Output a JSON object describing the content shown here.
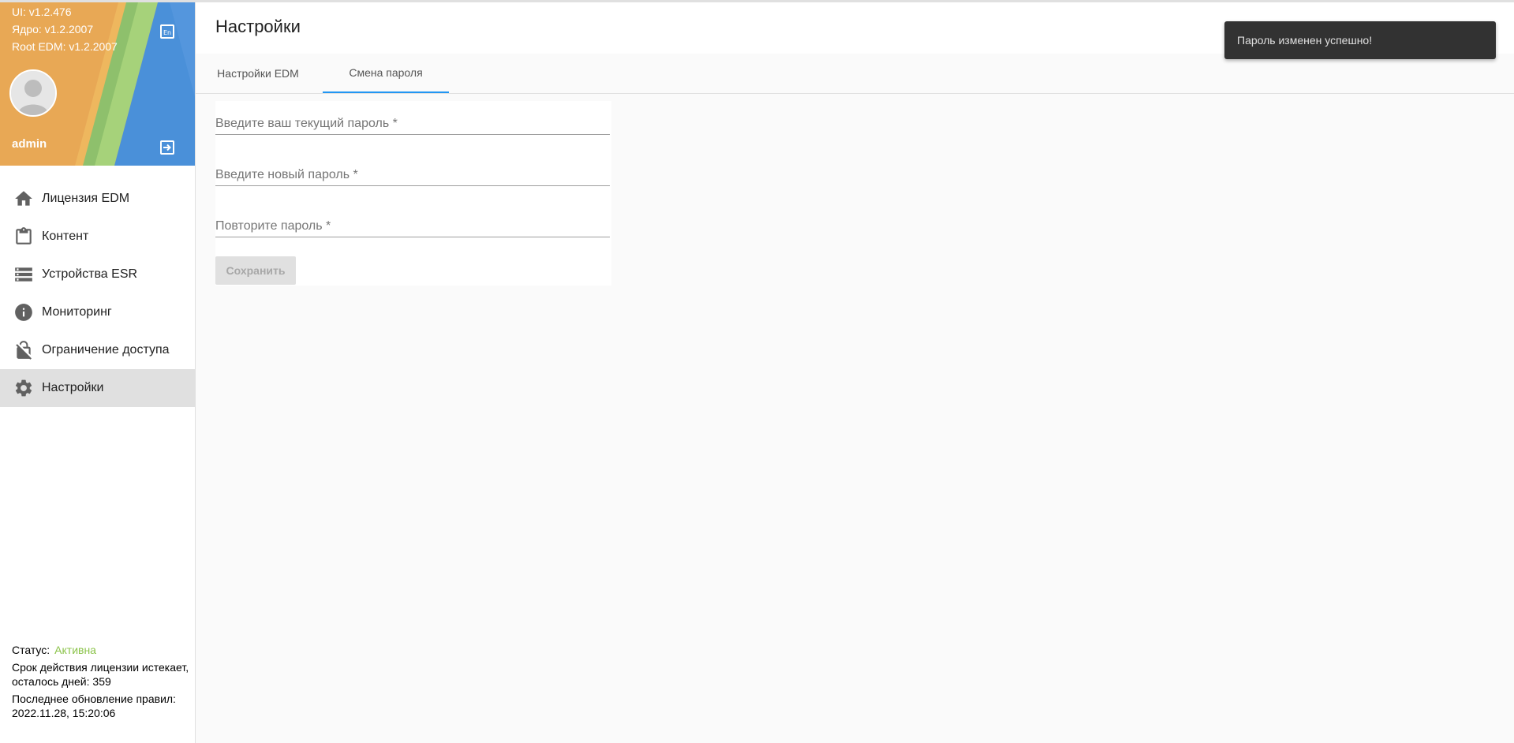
{
  "sidebar": {
    "versions": {
      "ui": "UI: v1.2.476",
      "core": "Ядро: v1.2.2007",
      "root_edm": "Root EDM: v1.2.2007"
    },
    "username": "admin",
    "items": [
      {
        "label": "Лицензия EDM",
        "icon": "home-icon",
        "active": false
      },
      {
        "label": "Контент",
        "icon": "clipboard-icon",
        "active": false
      },
      {
        "label": "Устройства ESR",
        "icon": "storage-list-icon",
        "active": false
      },
      {
        "label": "Мониторинг",
        "icon": "info-icon",
        "active": false
      },
      {
        "label": "Ограничение доступа",
        "icon": "lock-off-icon",
        "active": false
      },
      {
        "label": "Настройки",
        "icon": "gear-icon",
        "active": true
      }
    ],
    "footer": {
      "status_label": "Статус:",
      "status_value": "Активна",
      "license_text": "Срок действия лицензии истекает, осталось дней: 359",
      "rules_text": "Последнее обновление правил: 2022.11.28, 15:20:06"
    }
  },
  "main": {
    "title": "Настройки",
    "tabs": [
      {
        "label": "Настройки EDM",
        "active": false
      },
      {
        "label": "Смена пароля",
        "active": true
      }
    ],
    "form": {
      "current_password_placeholder": "Введите ваш текущий пароль *",
      "new_password_placeholder": "Введите новый пароль *",
      "repeat_password_placeholder": "Повторите пароль *",
      "save_label": "Сохранить"
    }
  },
  "toast": {
    "message": "Пароль изменен успешно!"
  },
  "colors": {
    "accent": "#2196f3",
    "status_active": "#8bc34a",
    "toast_bg": "#323232"
  }
}
